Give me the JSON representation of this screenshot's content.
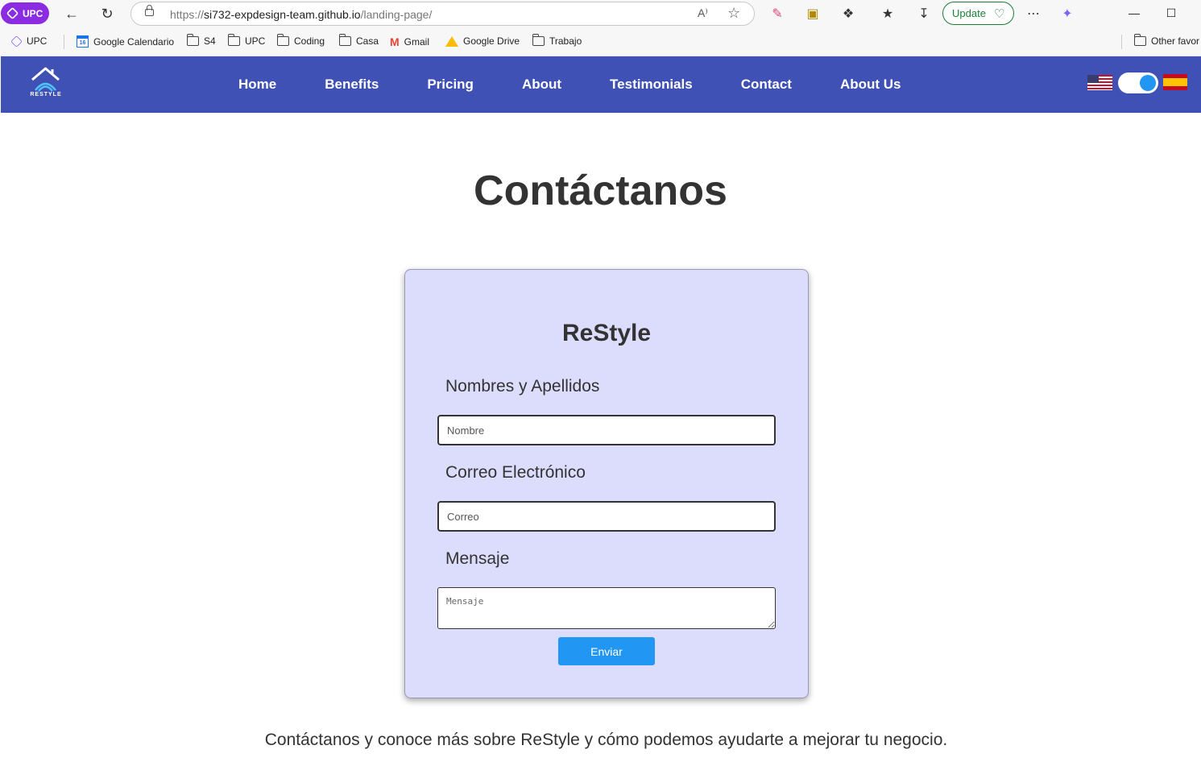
{
  "browser": {
    "profile_label": "UPC",
    "url_prefix": "https://",
    "url_host": "si732-expdesign-team.github.io",
    "url_path": "/landing-page/",
    "read_aloud": "A⁾",
    "update_label": "Update",
    "bookmarks": [
      "UPC",
      "Google Calendario",
      "S4",
      "UPC",
      "Coding",
      "Casa",
      "Gmail",
      "Google Drive",
      "Trabajo"
    ],
    "other_favorites": "Other favor",
    "calendar_day": "16"
  },
  "nav": {
    "logo_text": "RESTYLE",
    "items": [
      "Home",
      "Benefits",
      "Pricing",
      "About",
      "Testimonials",
      "Contact",
      "About Us"
    ]
  },
  "main": {
    "title": "Contáctanos",
    "card_title": "ReStyle",
    "name_label": "Nombres y Apellidos",
    "name_placeholder": "Nombre",
    "email_label": "Correo Electrónico",
    "email_placeholder": "Correo",
    "message_label": "Mensaje",
    "message_placeholder": "Mensaje",
    "submit_label": "Enviar",
    "footer": "Contáctanos y conoce más sobre ReStyle y cómo podemos ayudarte a mejorar tu negocio."
  },
  "colors": {
    "nav_bg": "#3f51b5",
    "card_bg": "#dcdcfc",
    "accent": "#2196f3"
  }
}
